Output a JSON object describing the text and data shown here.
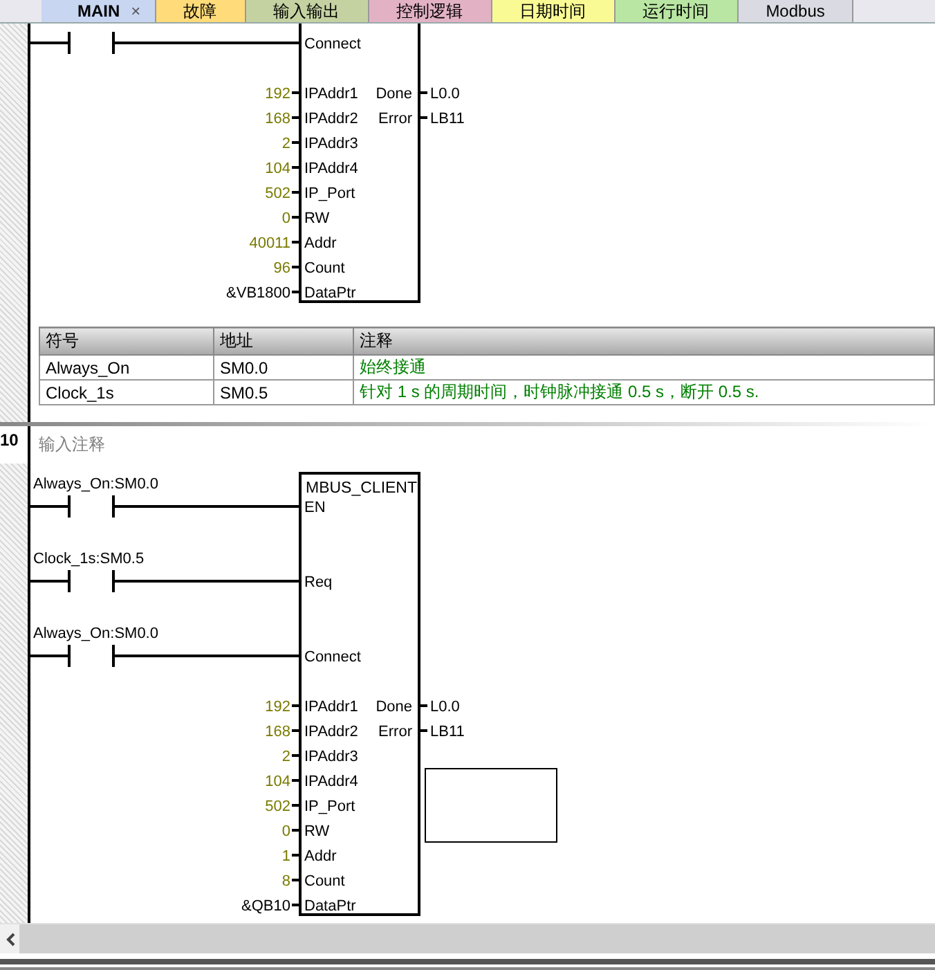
{
  "tabs": [
    {
      "label": "MAIN",
      "selected": true,
      "color": "#c9d6f2",
      "close": "×"
    },
    {
      "label": "故障",
      "selected": false,
      "color": "#ffdb7a"
    },
    {
      "label": "输入输出",
      "selected": false,
      "color": "#c4d2a2"
    },
    {
      "label": "控制逻辑",
      "selected": false,
      "color": "#e2b2c4"
    },
    {
      "label": "日期时间",
      "selected": false,
      "color": "#fafa94"
    },
    {
      "label": "运行时间",
      "selected": false,
      "color": "#b9e6a2"
    },
    {
      "label": "Modbus",
      "selected": false,
      "color": "#dadae2"
    }
  ],
  "networks": [
    {
      "contacts": [
        {
          "pin": "Connect"
        }
      ],
      "inputs": [
        {
          "value": "192",
          "pin": "IPAddr1",
          "constant": true
        },
        {
          "value": "168",
          "pin": "IPAddr2",
          "constant": true
        },
        {
          "value": "2",
          "pin": "IPAddr3",
          "constant": true
        },
        {
          "value": "104",
          "pin": "IPAddr4",
          "constant": true
        },
        {
          "value": "502",
          "pin": "IP_Port",
          "constant": true
        },
        {
          "value": "0",
          "pin": "RW",
          "constant": true
        },
        {
          "value": "40011",
          "pin": "Addr",
          "constant": true
        },
        {
          "value": "96",
          "pin": "Count",
          "constant": true
        },
        {
          "value": "&VB1800",
          "pin": "DataPtr",
          "constant": false
        }
      ],
      "outputs": [
        {
          "pin": "Done",
          "value": "L0.0"
        },
        {
          "pin": "Error",
          "value": "LB11"
        }
      ],
      "symbol_table": {
        "columns": [
          "符号",
          "地址",
          "注释"
        ],
        "rows": [
          [
            "Always_On",
            "SM0.0",
            "始终接通"
          ],
          [
            "Clock_1s",
            "SM0.5",
            "针对 1 s 的周期时间，时钟脉冲接通 0.5 s，断开 0.5 s."
          ]
        ]
      }
    },
    {
      "number": "10",
      "comment": "输入注释",
      "block_title": "MBUS_CLIENT",
      "contacts": [
        {
          "label": "Always_On:SM0.0",
          "pin": "EN"
        },
        {
          "label": "Clock_1s:SM0.5",
          "pin": "Req"
        },
        {
          "label": "Always_On:SM0.0",
          "pin": "Connect"
        }
      ],
      "inputs": [
        {
          "value": "192",
          "pin": "IPAddr1",
          "constant": true
        },
        {
          "value": "168",
          "pin": "IPAddr2",
          "constant": true
        },
        {
          "value": "2",
          "pin": "IPAddr3",
          "constant": true
        },
        {
          "value": "104",
          "pin": "IPAddr4",
          "constant": true
        },
        {
          "value": "502",
          "pin": "IP_Port",
          "constant": true
        },
        {
          "value": "0",
          "pin": "RW",
          "constant": true
        },
        {
          "value": "1",
          "pin": "Addr",
          "constant": true
        },
        {
          "value": "8",
          "pin": "Count",
          "constant": true
        },
        {
          "value": "&QB10",
          "pin": "DataPtr",
          "constant": false
        }
      ],
      "outputs": [
        {
          "pin": "Done",
          "value": "L0.0"
        },
        {
          "pin": "Error",
          "value": "LB11"
        }
      ],
      "empty_box": true
    }
  ]
}
